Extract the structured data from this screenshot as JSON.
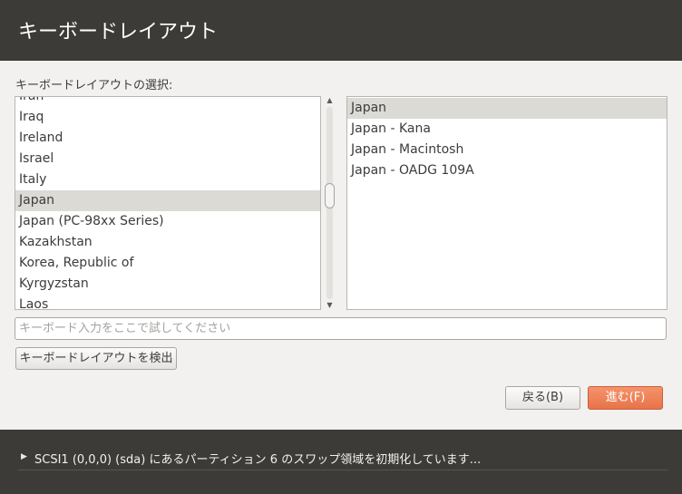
{
  "header": {
    "title": "キーボードレイアウト"
  },
  "layout_section": {
    "label": "キーボードレイアウトの選択:"
  },
  "layouts": [
    {
      "label": "Iran",
      "selected": false
    },
    {
      "label": "Iraq",
      "selected": false
    },
    {
      "label": "Ireland",
      "selected": false
    },
    {
      "label": "Israel",
      "selected": false
    },
    {
      "label": "Italy",
      "selected": false
    },
    {
      "label": "Japan",
      "selected": true
    },
    {
      "label": "Japan (PC-98xx Series)",
      "selected": false
    },
    {
      "label": "Kazakhstan",
      "selected": false
    },
    {
      "label": "Korea, Republic of",
      "selected": false
    },
    {
      "label": "Kyrgyzstan",
      "selected": false
    },
    {
      "label": "Laos",
      "selected": false
    }
  ],
  "variants": [
    {
      "label": "Japan",
      "selected": true
    },
    {
      "label": "Japan - Kana",
      "selected": false
    },
    {
      "label": "Japan - Macintosh",
      "selected": false
    },
    {
      "label": "Japan - OADG 109A",
      "selected": false
    }
  ],
  "test_input": {
    "value": "",
    "placeholder": "キーボード入力をここで試してください"
  },
  "buttons": {
    "detect_label": "キーボードレイアウトを検出",
    "back_label": "戻る(B)",
    "forward_label": "進む(F)"
  },
  "footer": {
    "progress_text": "SCSI1 (0,0,0) (sda) にあるパーティション 6 のスワップ領域を初期化しています..."
  },
  "colors": {
    "header_bg": "#3c3b37",
    "accent": "#e8734a",
    "selection": "#dcdad5"
  },
  "icons": {
    "scroll_up": "triangle-up-icon",
    "scroll_down": "triangle-down-icon",
    "progress": "triangle-right-icon"
  }
}
